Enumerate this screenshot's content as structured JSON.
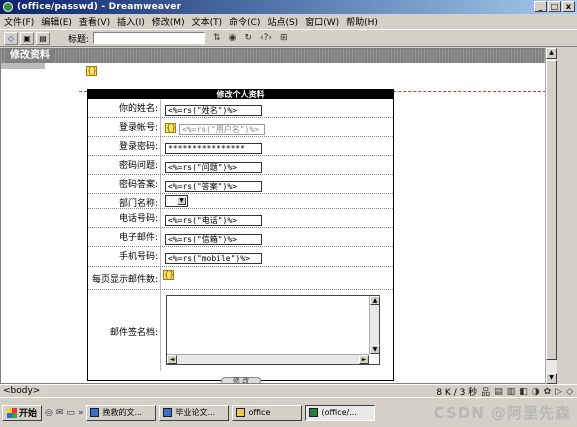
{
  "window": {
    "title": "(office/passwd) - Dreamweaver",
    "controls": [
      "_",
      "□",
      "x"
    ]
  },
  "menu": [
    "文件(F)",
    "编辑(E)",
    "查看(V)",
    "插入(I)",
    "修改(M)",
    "文本(T)",
    "命令(C)",
    "站点(S)",
    "窗口(W)",
    "帮助(H)"
  ],
  "toolbar": {
    "title_label": "标题:",
    "title_value": "",
    "icons": [
      "code-view-icon",
      "split-view-icon",
      "design-view-icon",
      "file-management-icon",
      "preview-icon",
      "refresh-icon",
      "code-nav-icon",
      "view-options-icon"
    ]
  },
  "page": {
    "header_title": "修改资料",
    "form_title": "修改个人资料",
    "fields": [
      {
        "label": "你的姓名:",
        "value": "<%=rs(\"姓名\")%>",
        "kind": "text"
      },
      {
        "label": "登录帐号:",
        "value": "<%=rs(\"用户名\")%>",
        "kind": "disabled"
      },
      {
        "label": "登录密码:",
        "value": "****************",
        "kind": "text"
      },
      {
        "label": "密码问题:",
        "value": "<%=rs(\"问题\")%>",
        "kind": "text"
      },
      {
        "label": "密码答案:",
        "value": "<%=rs(\"答案\")%>",
        "kind": "text"
      },
      {
        "label": "部门名称:",
        "value": "",
        "kind": "select"
      },
      {
        "label": "电话号码:",
        "value": "<%=rs(\"电话\")%>",
        "kind": "text"
      },
      {
        "label": "电子邮件:",
        "value": "<%=rs(\"信箱\")%>",
        "kind": "text"
      },
      {
        "label": "手机号码:",
        "value": "<%=rs(\"mobile\")%>",
        "kind": "text"
      },
      {
        "label": "每页显示邮件数:",
        "value": "",
        "kind": "icon"
      },
      {
        "label": "邮件签名档:",
        "value": "",
        "kind": "textarea"
      }
    ],
    "submit_label": "修 改"
  },
  "status": {
    "tag": "<body>",
    "size": "8 K / 3 秒"
  },
  "taskbar": {
    "start": "开始",
    "tasks": [
      "挽救的文...",
      "毕业论文...",
      "office",
      "(office/..."
    ],
    "watermark": "CSDN @阿里先森"
  }
}
